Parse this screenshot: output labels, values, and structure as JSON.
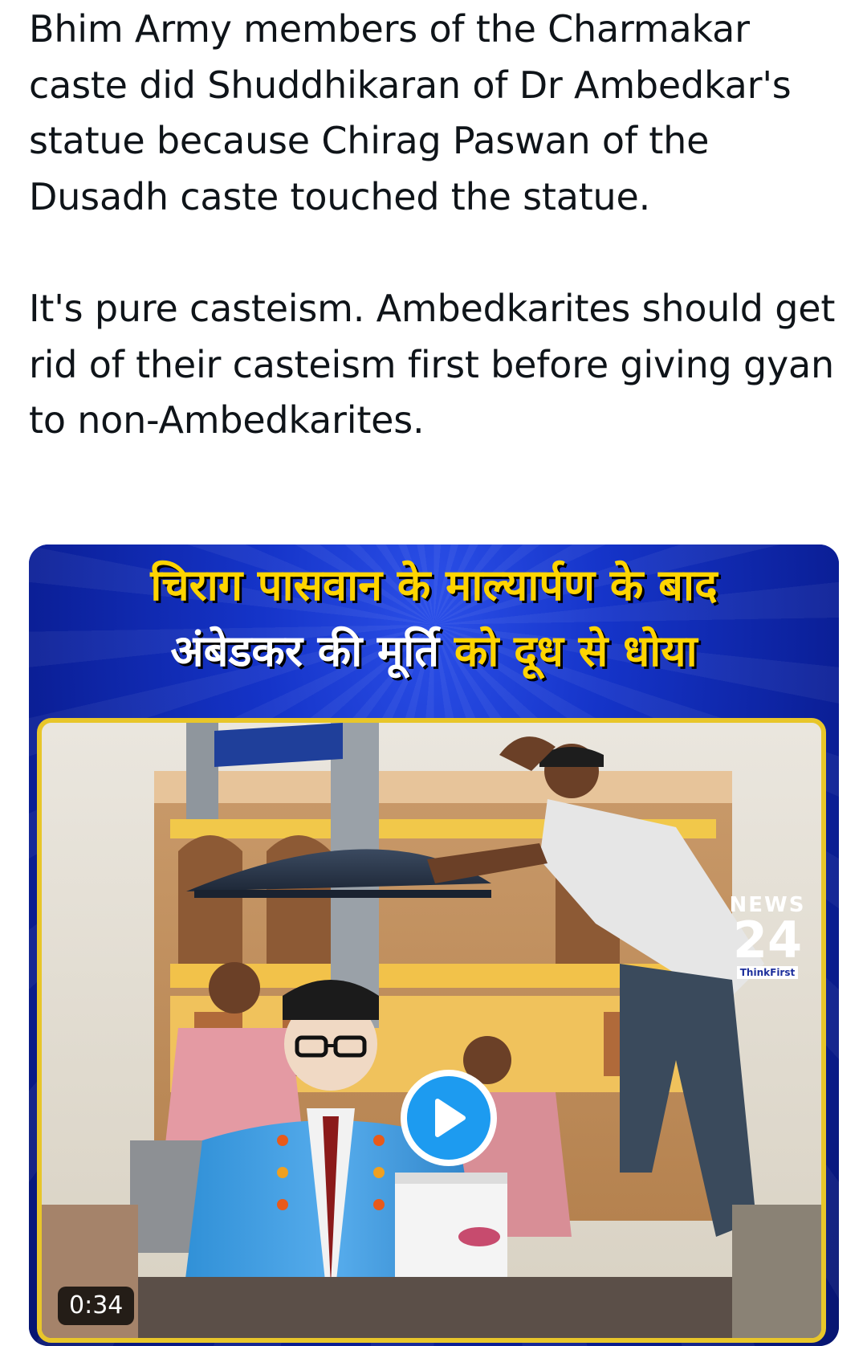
{
  "tweet": {
    "paragraphs": [
      "Bhim Army members of the Charmakar caste did Shuddhikaran of Dr Ambedkar's statue because Chirag Paswan of the Dusadh caste touched the statue.",
      "It's pure casteism. Ambedkarites should get rid of their casteism first before giving gyan to non-Ambedkarites."
    ]
  },
  "media": {
    "headline_line1": "चिराग पासवान के माल्यार्पण के बाद",
    "headline_line2_white": "अंबेडकर की मूर्ति ",
    "headline_line2_yellow": "को दूध से धोया",
    "brand": {
      "top": "NEWS",
      "mid": "24",
      "bottom": "ThinkFirst"
    },
    "duration": "0:34",
    "play_icon": "play-icon",
    "accent_color": "#1d9bf0",
    "frame_color": "#e8c62a",
    "background_color": "#0b1f97"
  }
}
